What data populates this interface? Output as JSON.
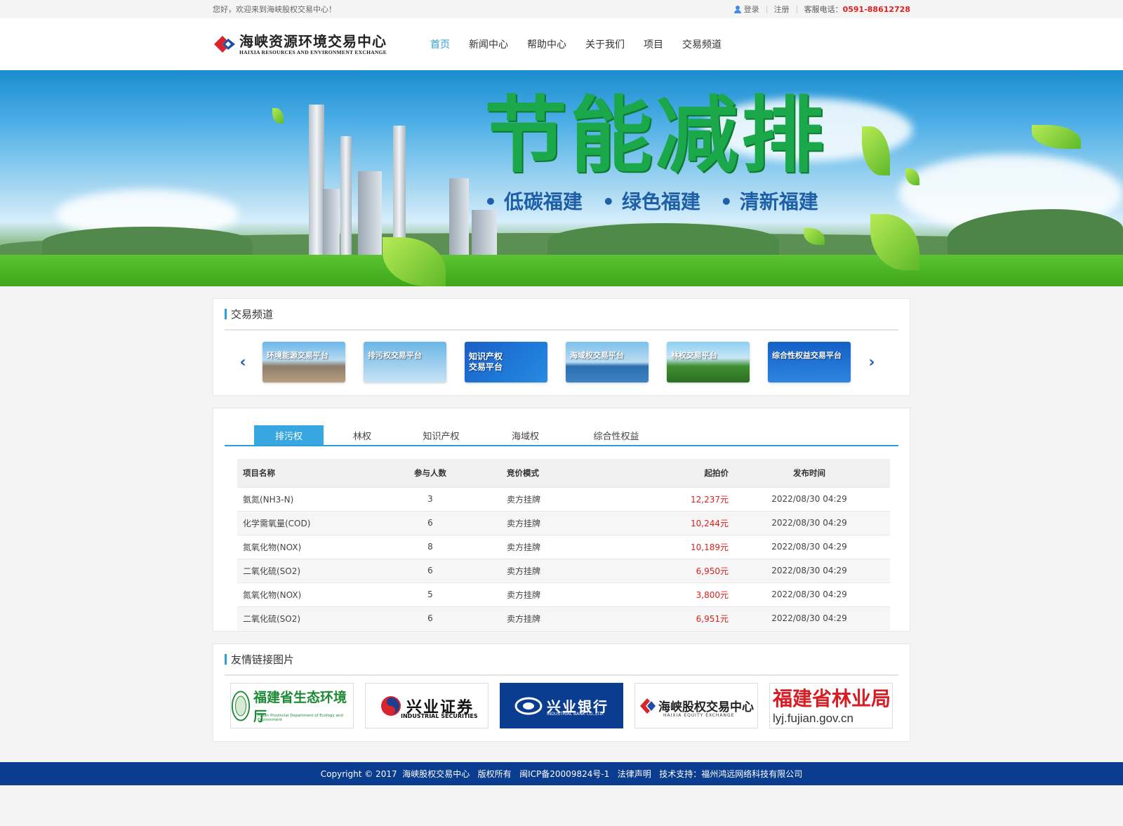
{
  "topbar": {
    "welcome": "您好，欢迎来到海峡股权交易中心！",
    "login": "登录",
    "register": "注册",
    "phone_label": "客服电话：",
    "phone": "0591-88612728"
  },
  "header": {
    "logo_cn": "海峡资源环境交易中心",
    "logo_en": "HAIXIA RESOURCES AND ENVIRONMENT EXCHANGE",
    "nav": [
      "首页",
      "新闻中心",
      "帮助中心",
      "关于我们",
      "项目",
      "交易频道"
    ]
  },
  "banner": {
    "headline": "节能减排",
    "slogans": [
      "低碳福建",
      "绿色福建",
      "清新福建"
    ]
  },
  "channels": {
    "title": "交易频道",
    "items": [
      "环境能源交易平台",
      "排污权交易平台",
      "知识产权",
      "交易平台",
      "海域权交易平台",
      "林权交易平台",
      "综合性权益交易平台"
    ]
  },
  "trade": {
    "tabs": [
      "排污权",
      "林权",
      "知识产权",
      "海域权",
      "综合性权益"
    ],
    "headers": [
      "项目名称",
      "参与人数",
      "竞价模式",
      "起拍价",
      "发布时间"
    ],
    "rows": [
      {
        "name": "氨氮(NH3-N)",
        "count": "3",
        "mode": "卖方挂牌",
        "price": "12,237元",
        "time": "2022/08/30 04:29"
      },
      {
        "name": "化学需氧量(COD)",
        "count": "6",
        "mode": "卖方挂牌",
        "price": "10,244元",
        "time": "2022/08/30 04:29"
      },
      {
        "name": "氮氧化物(NOX)",
        "count": "8",
        "mode": "卖方挂牌",
        "price": "10,189元",
        "time": "2022/08/30 04:29"
      },
      {
        "name": "二氧化硫(SO2)",
        "count": "6",
        "mode": "卖方挂牌",
        "price": "6,950元",
        "time": "2022/08/30 04:29"
      },
      {
        "name": "氮氧化物(NOX)",
        "count": "5",
        "mode": "卖方挂牌",
        "price": "3,800元",
        "time": "2022/08/30 04:29"
      },
      {
        "name": "二氧化硫(SO2)",
        "count": "6",
        "mode": "卖方挂牌",
        "price": "6,951元",
        "time": "2022/08/30 04:29"
      }
    ]
  },
  "links": {
    "title": "友情链接图片",
    "items": [
      {
        "title": "福建省生态环境厅",
        "sub": "Fujian Provincial Department of Ecology and Environment"
      },
      {
        "title": "兴业证券",
        "sub": "INDUSTRIAL SECURITIES"
      },
      {
        "title": "兴业银行",
        "sub": "INDUSTRIAL BANK CO.,LTD."
      },
      {
        "title": "海峡股权交易中心",
        "sub": "HAIXIA EQUITY EXCHANGE"
      },
      {
        "title": "福建省林业局",
        "sub": "lyj.fujian.gov.cn"
      }
    ]
  },
  "footer": {
    "text": "Copyright © 2017  海峡股权交易中心   版权所有   闽ICP备20009824号-1   法律声明   技术支持：福州鸿远网络科技有限公司"
  }
}
